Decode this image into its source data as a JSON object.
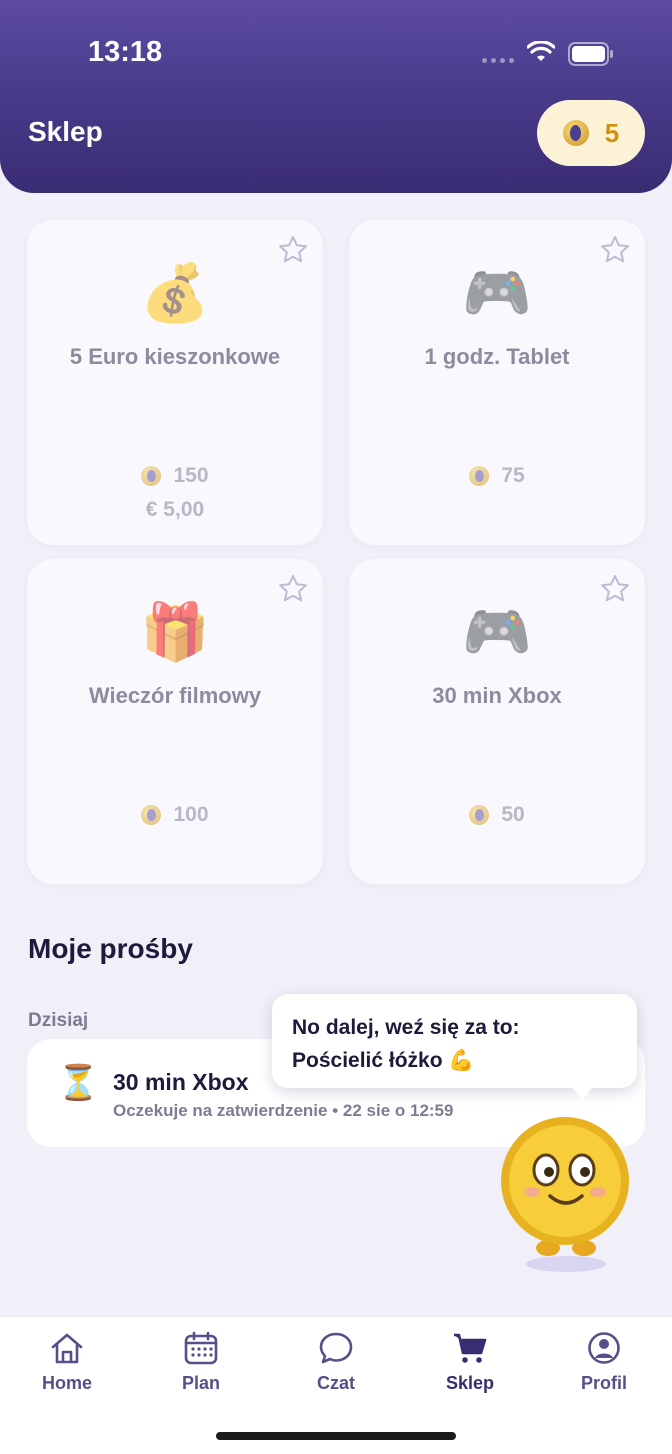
{
  "status_bar": {
    "time": "13:18"
  },
  "header": {
    "title": "Sklep",
    "coin_balance": "5"
  },
  "rewards": [
    {
      "icon": "money-bag-icon",
      "emoji": "💰",
      "name": "5 Euro kieszonkowe",
      "cost": "150",
      "euro": "€ 5,00"
    },
    {
      "icon": "game-controller-icon",
      "emoji": "🎮",
      "name": "1 godz. Tablet",
      "cost": "75"
    },
    {
      "icon": "gift-icon",
      "emoji": "🎁",
      "name": "Wieczór filmowy",
      "cost": "100"
    },
    {
      "icon": "game-controller-icon",
      "emoji": "🎮",
      "name": "30 min Xbox",
      "cost": "50"
    }
  ],
  "requests": {
    "title": "Moje prośby",
    "day_label": "Dzisiaj",
    "items": [
      {
        "icon": "hourglass-icon",
        "emoji": "⏳",
        "name": "30 min Xbox",
        "status": "Oczekuje na zatwierdzenie",
        "time": "22 sie o 12:59"
      }
    ]
  },
  "mascot": {
    "line1": "No dalej, weź się za to:",
    "line2": "Pościelić łóżko 💪"
  },
  "tab_bar": {
    "active": "Sklep",
    "tabs": [
      {
        "icon": "home-icon",
        "label": "Home"
      },
      {
        "icon": "calendar-icon",
        "label": "Plan"
      },
      {
        "icon": "chat-icon",
        "label": "Czat"
      },
      {
        "icon": "cart-icon",
        "label": "Sklep"
      },
      {
        "icon": "profile-icon",
        "label": "Profil"
      }
    ]
  },
  "colors": {
    "header": "#4a3b8c",
    "accent": "#d4900f",
    "background": "#f1f0f9"
  }
}
